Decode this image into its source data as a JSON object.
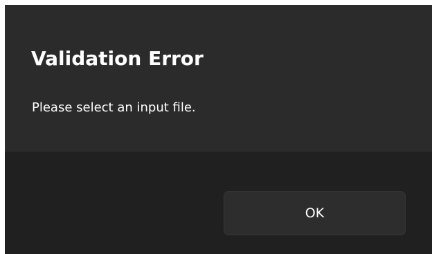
{
  "dialog": {
    "title": "Validation Error",
    "message": "Please select an input file.",
    "ok_label": "OK"
  },
  "colors": {
    "content_background": "#2b2b2b",
    "footer_background": "#202020",
    "button_background": "#2d2d2d",
    "text": "#ffffff"
  }
}
